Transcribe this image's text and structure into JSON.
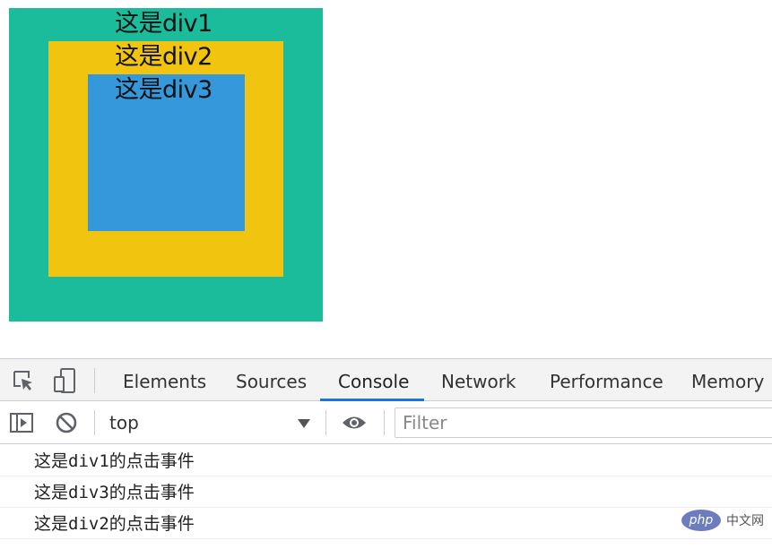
{
  "demo": {
    "div1_label": "这是div1",
    "div2_label": "这是div2",
    "div3_label": "这是div3",
    "colors": {
      "div1": "#1abc9c",
      "div2": "#f1c40f",
      "div3": "#3498db"
    }
  },
  "devtools": {
    "icons": {
      "inspect": "inspect-element-icon",
      "device": "device-toolbar-icon",
      "sidebar": "show-sidebar-icon",
      "clear": "clear-console-icon",
      "eye": "live-expression-icon"
    },
    "tabs": [
      {
        "label": "Elements"
      },
      {
        "label": "Sources"
      },
      {
        "label": "Console"
      },
      {
        "label": "Network"
      },
      {
        "label": "Performance"
      },
      {
        "label": "Memory"
      }
    ],
    "active_tab": "Console",
    "context": "top",
    "filter_placeholder": "Filter",
    "console_messages": [
      "这是div1的点击事件",
      "这是div3的点击事件",
      "这是div2的点击事件"
    ],
    "accent_color": "#1a73e8"
  },
  "watermark": {
    "logo": "php",
    "text": "中文网"
  }
}
